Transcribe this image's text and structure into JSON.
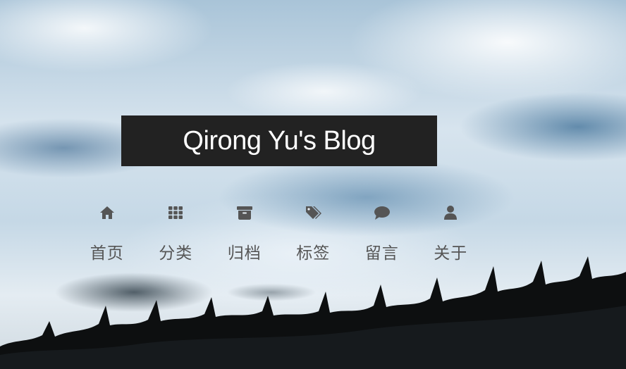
{
  "site": {
    "title": "Qirong Yu's Blog"
  },
  "nav": {
    "items": [
      {
        "label": "首页",
        "icon": "home-icon"
      },
      {
        "label": "分类",
        "icon": "grid-icon"
      },
      {
        "label": "归档",
        "icon": "archive-icon"
      },
      {
        "label": "标签",
        "icon": "tags-icon"
      },
      {
        "label": "留言",
        "icon": "comment-icon"
      },
      {
        "label": "关于",
        "icon": "user-icon"
      }
    ]
  },
  "colors": {
    "title_bg": "#222222",
    "title_text": "#ffffff",
    "nav_text": "#555555",
    "nav_icon": "#555555"
  }
}
